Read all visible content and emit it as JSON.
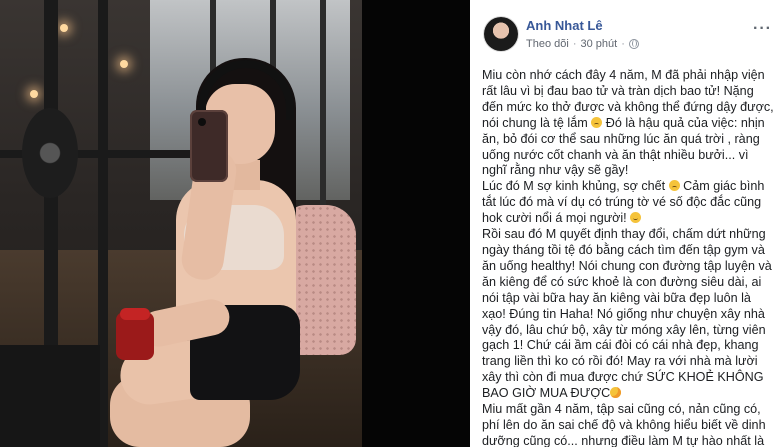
{
  "post": {
    "author": "Anh Nhat Lê",
    "follow_label": "Theo dõi",
    "time": "30 phút",
    "separator": "·",
    "more_label": "···",
    "icons": {
      "avatar": "user-avatar",
      "privacy": "globe-icon",
      "more": "more-options-icon"
    },
    "paragraphs": [
      {
        "text": "Miu còn nhớ cách đây 4 năm, M đã phải nhập viện rất lâu vì bị đau bao tử và tràn dịch bao tử! Nặng đến mức ko thở được và không thể đứng dậy được, nói chung là tệ lắm",
        "emoji": "sad",
        "text2": " Đó là hậu quả của việc: nhịn ăn, bỏ đói cơ thể sau những lúc ăn quá trời , ràng uống nước cốt chanh và ăn thật nhiều bưởi... vì nghĩ rằng như vậy sẽ gầy!"
      },
      {
        "text": "Lúc đó M sợ kinh khủng, sợ chết",
        "emoji": "sad",
        "text2": " Cảm giác bình tắt lúc đó mà ví dụ có trúng tờ vé số độc đắc cũng hok cười nổi á mọi người!",
        "emoji2": "smile"
      },
      {
        "text": "Rồi sau đó M quyết định thay đổi, chấm dứt những ngày tháng tồi tệ đó bằng cách tìm đến tập gym và ăn uống healthy! Nói chung con đường tập luyện và ăn kiêng để có sức khoẻ là con đường siêu dài, ai nói tập vài bữa hay ăn kiêng vài bữa đẹp luôn là xạo! Đúng tin Haha! Nó giống như chuyện xây nhà vậy đó, lâu chứ bộ, xây từ móng xây lên, từng viên gạch 1! Chứ cái ầm cái đòi có cái nhà đẹp, khang trang liền thì ko có rồi đó! May ra với nhà mà lười xây thì còn đi mua được chứ SỨC KHOẺ KHÔNG BAO GIỜ MUA ĐƯỢC",
        "emoji": "love"
      },
      {
        "text": "Miu mất gần 4 năm, tập sai cũng có, nản cũng có, phí lên do ăn sai chế độ và không hiểu biết về dinh dưỡng cũng có... nhưng điều làm M tự hào nhất là"
      }
    ]
  }
}
